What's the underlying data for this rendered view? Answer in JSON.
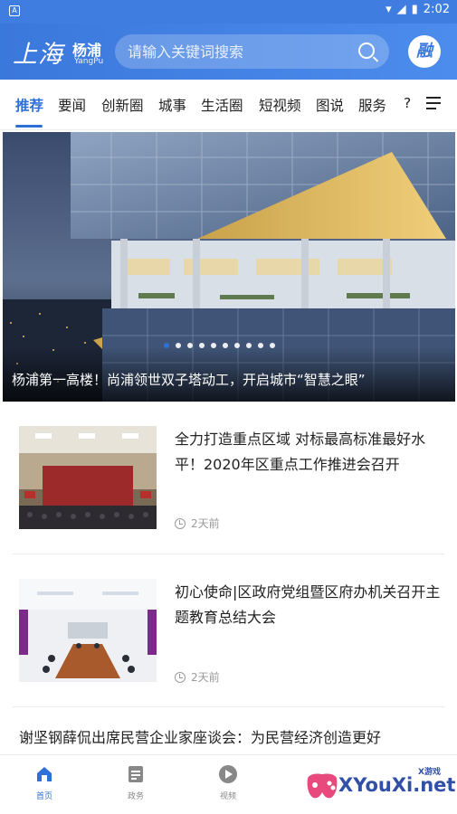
{
  "status_bar": {
    "time": "2:02"
  },
  "header": {
    "logo_text": "上海",
    "logo_sub": "杨浦",
    "logo_en": "YangPu",
    "search_placeholder": "请输入关键词搜索",
    "avatar_text": "融"
  },
  "tabs": [
    "推荐",
    "要闻",
    "创新圈",
    "城事",
    "生活圈",
    "短视频",
    "图说",
    "服务",
    "?"
  ],
  "active_tab": "推荐",
  "banner": {
    "caption": "杨浦第一高楼！尚浦领世双子塔动工，开启城市“智慧之眼”",
    "dot_count": 10,
    "active_dot": 0
  },
  "news": [
    {
      "title": "全力打造重点区域 对标最高标准最好水平！2020年区重点工作推进会召开",
      "time": "2天前"
    },
    {
      "title": "初心使命|区政府党组暨区府办机关召开主题教育总结大会",
      "time": "2天前"
    }
  ],
  "third_news_title": "谢坚钢薛侃出席民营企业家座谈会：为民营经济创造更好",
  "bottom_nav": [
    {
      "label": "首页",
      "icon": "home-icon",
      "active": true
    },
    {
      "label": "政务",
      "icon": "document-icon",
      "active": false
    },
    {
      "label": "视频",
      "icon": "play-icon",
      "active": false
    }
  ],
  "watermark": {
    "text": "XYouXi.net",
    "small": "X游戏"
  },
  "colors": {
    "accent": "#2e6fd8",
    "header": "#3b78dc"
  }
}
